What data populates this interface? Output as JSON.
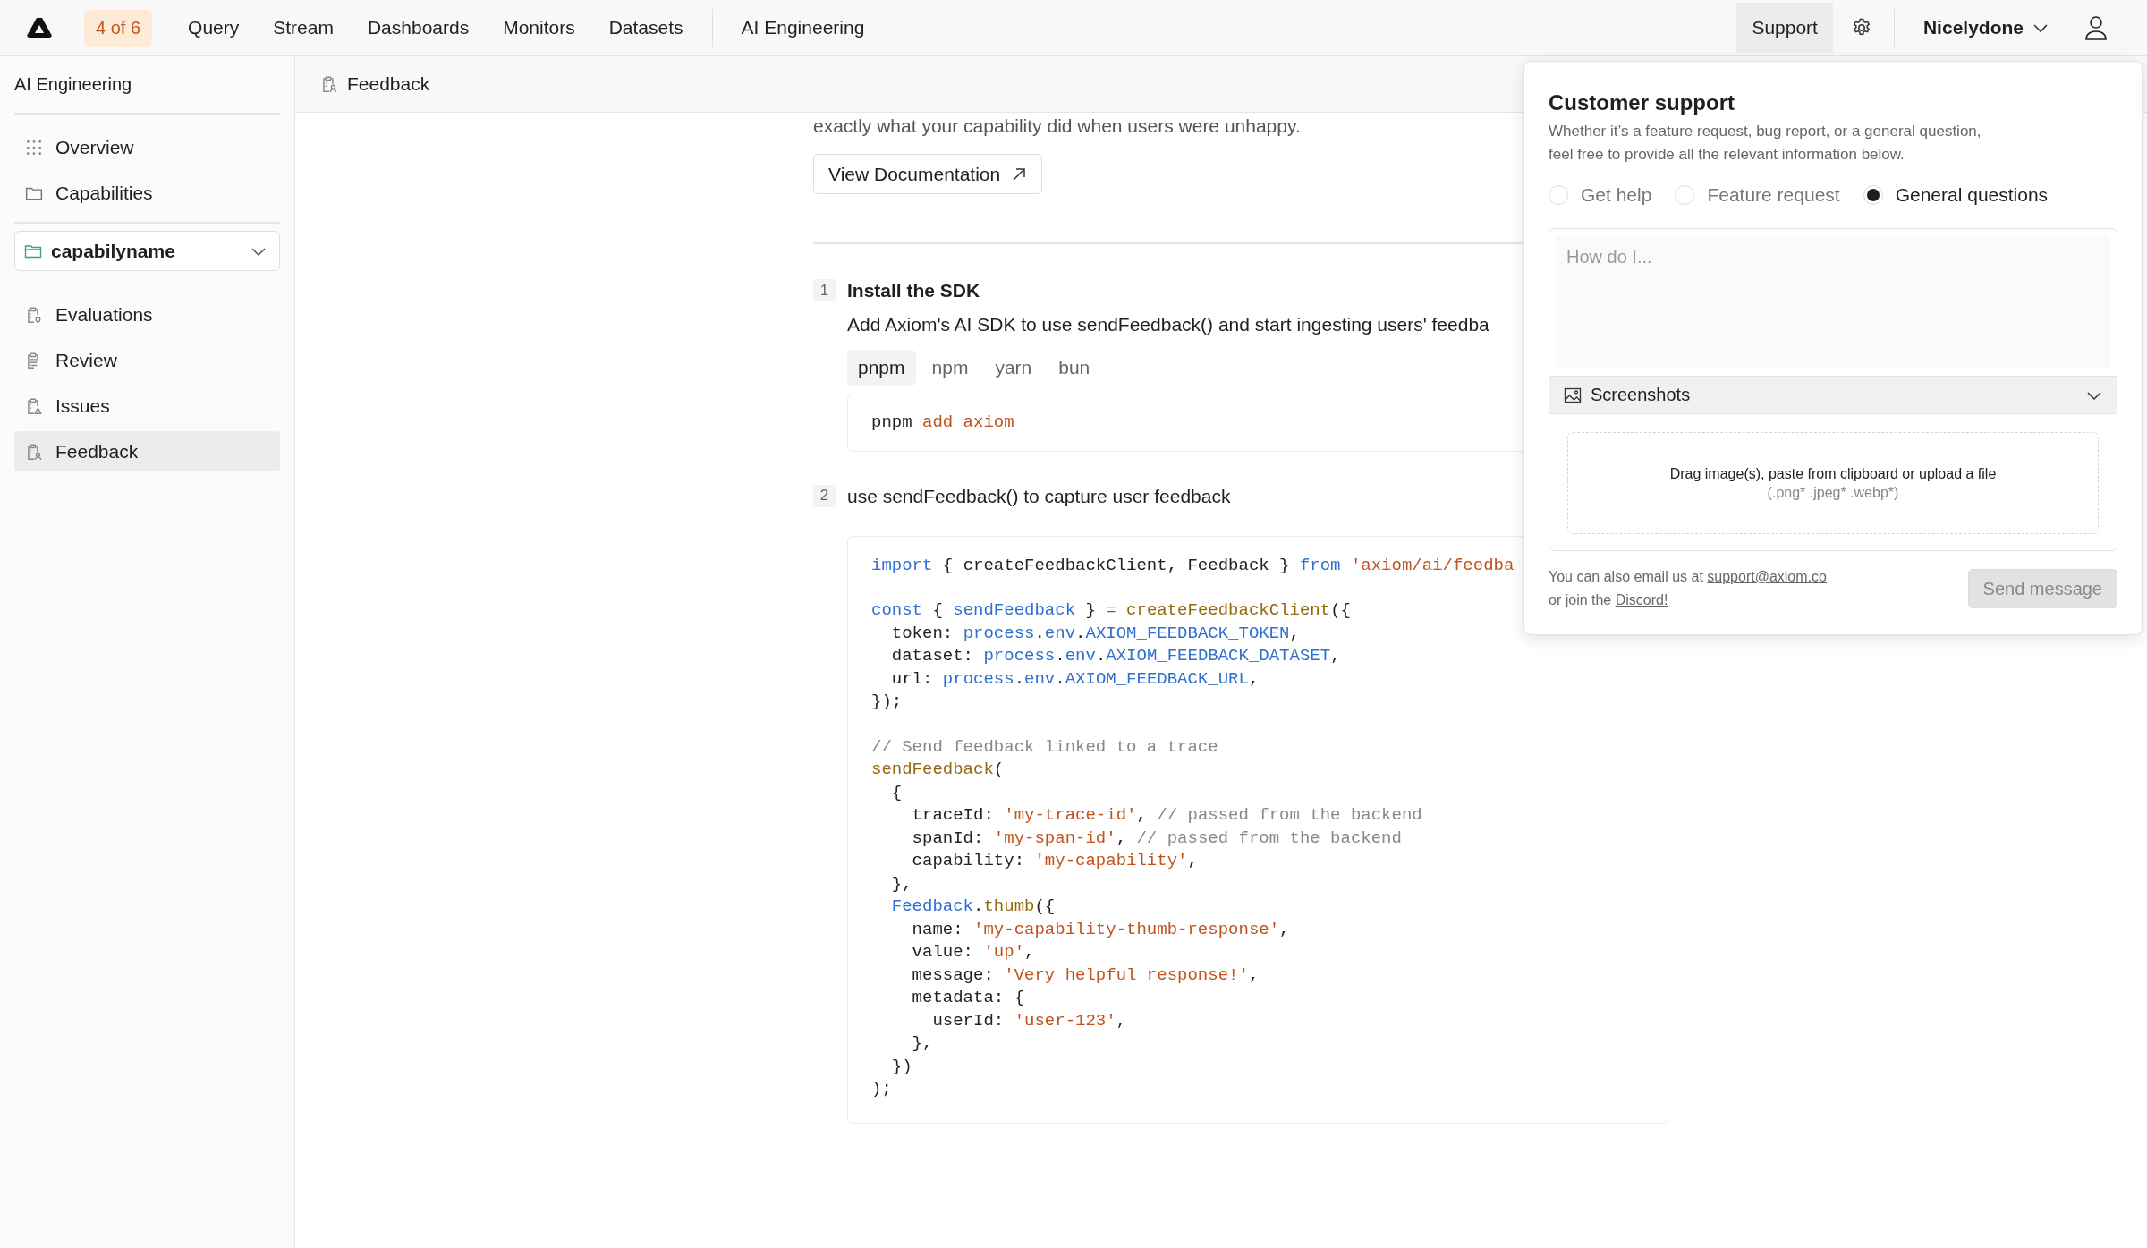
{
  "top_nav": {
    "badge": "4 of 6",
    "items": [
      {
        "label": "Query"
      },
      {
        "label": "Stream"
      },
      {
        "label": "Dashboards"
      },
      {
        "label": "Monitors"
      },
      {
        "label": "Datasets"
      }
    ],
    "section": "AI Engineering",
    "support": "Support",
    "account": "Nicelydone"
  },
  "sidebar": {
    "title": "AI Engineering",
    "items": [
      {
        "label": "Overview",
        "kind": "grid",
        "selected": false
      },
      {
        "label": "Capabilities",
        "kind": "folder",
        "selected": false
      }
    ],
    "capability_select": {
      "value": "capabilyname"
    },
    "capability_items": [
      {
        "label": "Evaluations",
        "kind": "clipboard-shield",
        "selected": false
      },
      {
        "label": "Review",
        "kind": "clipboard-list",
        "selected": false
      },
      {
        "label": "Issues",
        "kind": "clipboard-warning",
        "selected": false
      },
      {
        "label": "Feedback",
        "kind": "clipboard-user",
        "selected": true
      }
    ]
  },
  "breadcrumb": {
    "label": "Feedback"
  },
  "content": {
    "intro": "exactly what your capability did when users were unhappy.",
    "docs_button": "View Documentation",
    "steps": [
      {
        "number": "1",
        "title": "Install the SDK",
        "description": "Add Axiom's AI SDK to use sendFeedback() and start ingesting users' feedba",
        "package_tabs": [
          {
            "label": "pnpm",
            "selected": true
          },
          {
            "label": "npm",
            "selected": false
          },
          {
            "label": "yarn",
            "selected": false
          },
          {
            "label": "bun",
            "selected": false
          }
        ],
        "code_blocks": [
          [
            [
              {
                "kind": "plain",
                "text": "pnpm "
              },
              {
                "kind": "string",
                "text": "add axiom"
              }
            ]
          ]
        ]
      },
      {
        "number": "2",
        "description": "use sendFeedback() to capture user feedback",
        "code_blocks": [
          [
            [
              {
                "kind": "keyword",
                "text": "import"
              },
              {
                "kind": "plain",
                "text": " { createFeedbackClient, Feedback } "
              },
              {
                "kind": "keyword",
                "text": "from "
              },
              {
                "kind": "string",
                "text": "'axiom/ai/feedba"
              }
            ]
          ],
          [
            [
              {
                "kind": "keyword",
                "text": "const"
              },
              {
                "kind": "plain",
                "text": " { "
              },
              {
                "kind": "keyword",
                "text": "sendFeedback"
              },
              {
                "kind": "plain",
                "text": " } "
              },
              {
                "kind": "keyword",
                "text": "= "
              },
              {
                "kind": "function",
                "text": "createFeedbackClient"
              },
              {
                "kind": "plain",
                "text": "({"
              }
            ],
            [
              {
                "kind": "plain",
                "text": "  token: "
              },
              {
                "kind": "keyword",
                "text": "process"
              },
              {
                "kind": "plain",
                "text": "."
              },
              {
                "kind": "keyword",
                "text": "env"
              },
              {
                "kind": "plain",
                "text": "."
              },
              {
                "kind": "keyword",
                "text": "AXIOM_FEEDBACK_TOKEN"
              },
              {
                "kind": "plain",
                "text": ","
              }
            ],
            [
              {
                "kind": "plain",
                "text": "  dataset: "
              },
              {
                "kind": "keyword",
                "text": "process"
              },
              {
                "kind": "plain",
                "text": "."
              },
              {
                "kind": "keyword",
                "text": "env"
              },
              {
                "kind": "plain",
                "text": "."
              },
              {
                "kind": "keyword",
                "text": "AXIOM_FEEDBACK_DATASET"
              },
              {
                "kind": "plain",
                "text": ","
              }
            ],
            [
              {
                "kind": "plain",
                "text": "  url: "
              },
              {
                "kind": "keyword",
                "text": "process"
              },
              {
                "kind": "plain",
                "text": "."
              },
              {
                "kind": "keyword",
                "text": "env"
              },
              {
                "kind": "plain",
                "text": "."
              },
              {
                "kind": "keyword",
                "text": "AXIOM_FEEDBACK_URL"
              },
              {
                "kind": "plain",
                "text": ","
              }
            ],
            [
              {
                "kind": "plain",
                "text": "});"
              }
            ]
          ],
          [
            [
              {
                "kind": "comment",
                "text": "// Send feedback linked to a trace"
              }
            ],
            [
              {
                "kind": "function",
                "text": "sendFeedback"
              },
              {
                "kind": "plain",
                "text": "("
              }
            ],
            [
              {
                "kind": "plain",
                "text": "  {"
              }
            ],
            [
              {
                "kind": "plain",
                "text": "    traceId: "
              },
              {
                "kind": "string",
                "text": "'my-trace-id'"
              },
              {
                "kind": "plain",
                "text": ", "
              },
              {
                "kind": "comment",
                "text": "// passed from the backend"
              }
            ],
            [
              {
                "kind": "plain",
                "text": "    spanId: "
              },
              {
                "kind": "string",
                "text": "'my-span-id'"
              },
              {
                "kind": "plain",
                "text": ", "
              },
              {
                "kind": "comment",
                "text": "// passed from the backend"
              }
            ],
            [
              {
                "kind": "plain",
                "text": "    capability: "
              },
              {
                "kind": "string",
                "text": "'my-capability'"
              },
              {
                "kind": "plain",
                "text": ","
              }
            ],
            [
              {
                "kind": "plain",
                "text": "  },"
              }
            ],
            [
              {
                "kind": "keyword",
                "text": "  Feedback"
              },
              {
                "kind": "plain",
                "text": "."
              },
              {
                "kind": "function",
                "text": "thumb"
              },
              {
                "kind": "plain",
                "text": "({"
              }
            ],
            [
              {
                "kind": "plain",
                "text": "    name: "
              },
              {
                "kind": "string",
                "text": "'my-capability-thumb-response'"
              },
              {
                "kind": "plain",
                "text": ","
              }
            ],
            [
              {
                "kind": "plain",
                "text": "    value: "
              },
              {
                "kind": "string",
                "text": "'up'"
              },
              {
                "kind": "plain",
                "text": ","
              }
            ],
            [
              {
                "kind": "plain",
                "text": "    message: "
              },
              {
                "kind": "string",
                "text": "'Very helpful response!'"
              },
              {
                "kind": "plain",
                "text": ","
              }
            ],
            [
              {
                "kind": "plain",
                "text": "    metadata: {"
              }
            ],
            [
              {
                "kind": "plain",
                "text": "      userId: "
              },
              {
                "kind": "string",
                "text": "'user-123'"
              },
              {
                "kind": "plain",
                "text": ","
              }
            ],
            [
              {
                "kind": "plain",
                "text": "    },"
              }
            ],
            [
              {
                "kind": "plain",
                "text": "  })"
              }
            ],
            [
              {
                "kind": "plain",
                "text": ");"
              }
            ]
          ]
        ]
      }
    ]
  },
  "support_panel": {
    "title": "Customer support",
    "subtitle": "Whether it’s a feature request, bug report, or a general question, feel free to provide all the relevant information below.",
    "topics": [
      {
        "label": "Get help",
        "selected": false
      },
      {
        "label": "Feature request",
        "selected": false
      },
      {
        "label": "General questions",
        "selected": true
      }
    ],
    "message": {
      "placeholder": "How do I..."
    },
    "screenshots": {
      "label": "Screenshots",
      "drop_text": "Drag image(s), paste from clipboard or ",
      "upload_link": "upload a file",
      "formats": "(.png* .jpeg* .webp*)"
    },
    "contact": {
      "email_text": "You can also email us at ",
      "email": "support@axiom.co",
      "discord_text": "or join the ",
      "discord": "Discord!"
    },
    "send_button": {
      "label": "Send message",
      "disabled": true
    }
  }
}
